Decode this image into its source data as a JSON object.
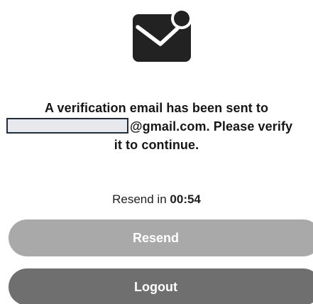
{
  "verification": {
    "message_line1": "A verification email has been sent to",
    "message_line2_suffix": "@gmail.com. Please verify",
    "message_line3": "it to continue.",
    "resend_prefix": "Resend in",
    "countdown": "00:54"
  },
  "buttons": {
    "resend_label": "Resend",
    "logout_label": "Logout"
  },
  "colors": {
    "icon": "#222222",
    "resend_button": "#a9a9a9",
    "logout_button": "#6f6f6f",
    "text": "#161616"
  },
  "icons": {
    "header": "mail-notification-icon"
  }
}
